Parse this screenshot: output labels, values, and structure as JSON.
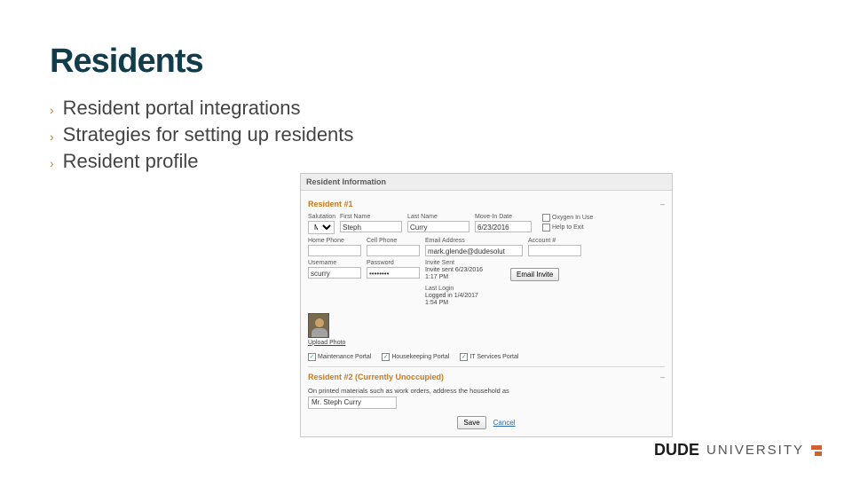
{
  "title": "Residents",
  "bullets": [
    "Resident portal integrations",
    "Strategies for setting up residents",
    "Resident profile"
  ],
  "panel": {
    "header": "Resident Information",
    "resident1": {
      "title": "Resident #1",
      "labels": {
        "salutation": "Salutation",
        "first": "First Name",
        "last": "Last Name",
        "movein": "Move-In Date",
        "home": "Home Phone",
        "cell": "Cell Phone",
        "email": "Email Address",
        "account": "Account #",
        "user": "Username",
        "pass": "Password",
        "invite": "Invite Sent",
        "login": "Last Login"
      },
      "salutation": "Mr.",
      "first": "Steph",
      "last": "Curry",
      "movein": "6/23/2016",
      "home": "",
      "cell": "",
      "email": "mark.glende@dudesolut",
      "account": "",
      "username": "scurry",
      "password": "••••••••",
      "invite_sent_line1": "Invite sent 6/23/2016",
      "invite_sent_line2": "1:17 PM",
      "last_login_line1": "Logged in 1/4/2017",
      "last_login_line2": "1:54 PM",
      "email_invite_btn": "Email Invite",
      "oxygen_label": "Oxygen In Use",
      "help_label": "Help to Exit",
      "upload_label": "Upload Photo",
      "portals": {
        "maint": "Maintenance Portal",
        "house": "Housekeeping Portal",
        "it": "IT Services Portal"
      }
    },
    "resident2": {
      "title": "Resident #2 (Currently Unoccupied)",
      "household_caption": "On printed materials such as work orders, address the household as",
      "household_value": "Mr. Steph Curry",
      "save": "Save",
      "cancel": "Cancel"
    }
  },
  "logo": {
    "dude": "DUDE",
    "univ": "UNIVERSITY"
  }
}
